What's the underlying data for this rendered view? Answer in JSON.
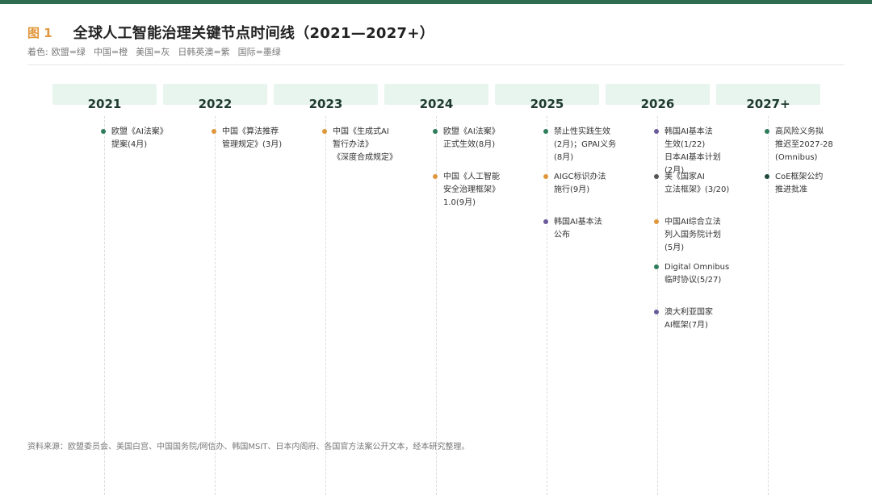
{
  "header": {
    "fig_label": "图 1",
    "title": "全球人工智能治理关键节点时间线（2021—2027+）"
  },
  "legend": {
    "prefix": "着色:",
    "items": [
      "欧盟=绿",
      "中国=橙",
      "美国=灰",
      "日韩英澳=紫",
      "国际=墨绿"
    ]
  },
  "colors": {
    "欧盟": "#2e7d5b",
    "中国": "#e0963a",
    "美国": "#555555",
    "日韩英澳": "#6b5b9a",
    "国际": "#1f4a3a"
  },
  "columns": [
    {
      "year": "2021",
      "events": [
        {
          "region": "欧盟",
          "lines": [
            "欧盟《AI法案》",
            "提案(4月)"
          ]
        }
      ]
    },
    {
      "year": "2022",
      "events": [
        {
          "region": "中国",
          "lines": [
            "中国《算法推荐",
            "管理规定》(3月)"
          ]
        }
      ]
    },
    {
      "year": "2023",
      "events": [
        {
          "region": "中国",
          "lines": [
            "中国《生成式AI",
            "暂行办法》",
            "《深度合成规定》"
          ]
        }
      ]
    },
    {
      "year": "2024",
      "events": [
        {
          "region": "欧盟",
          "lines": [
            "欧盟《AI法案》",
            "正式生效(8月)"
          ]
        },
        {
          "region": "中国",
          "lines": [
            "中国《人工智能",
            "安全治理框架》",
            "1.0(9月)"
          ]
        }
      ]
    },
    {
      "year": "2025",
      "events": [
        {
          "region": "欧盟",
          "lines": [
            "禁止性实践生效",
            "(2月)；GPAI义务",
            "(8月)"
          ]
        },
        {
          "region": "中国",
          "lines": [
            "AIGC标识办法",
            "施行(9月)"
          ]
        },
        {
          "region": "日韩英澳",
          "lines": [
            "韩国AI基本法",
            "公布"
          ]
        }
      ]
    },
    {
      "year": "2026",
      "events": [
        {
          "region": "日韩英澳",
          "lines": [
            "韩国AI基本法",
            "生效(1/22)",
            "日本AI基本计划",
            "(2月)"
          ]
        },
        {
          "region": "美国",
          "lines": [
            "美《国家AI",
            "立法框架》(3/20)"
          ]
        },
        {
          "region": "中国",
          "lines": [
            "中国AI综合立法",
            "列入国务院计划",
            "(5月)"
          ]
        },
        {
          "region": "欧盟",
          "lines": [
            "Digital Omnibus",
            "临时协议(5/27)"
          ]
        },
        {
          "region": "日韩英澳",
          "lines": [
            "澳大利亚国家",
            "AI框架(7月)"
          ]
        }
      ]
    },
    {
      "year": "2027+",
      "events": [
        {
          "region": "欧盟",
          "lines": [
            "高风险义务拟",
            "推迟至2027-28",
            "(Omnibus)"
          ]
        },
        {
          "region": "国际",
          "lines": [
            "CoE框架公约",
            "推进批准"
          ]
        }
      ]
    }
  ],
  "source": "资料来源：欧盟委员会、美国白宫、中国国务院/网信办、韩国MSIT、日本内阁府、各国官方法案公开文本，经本研究整理。"
}
